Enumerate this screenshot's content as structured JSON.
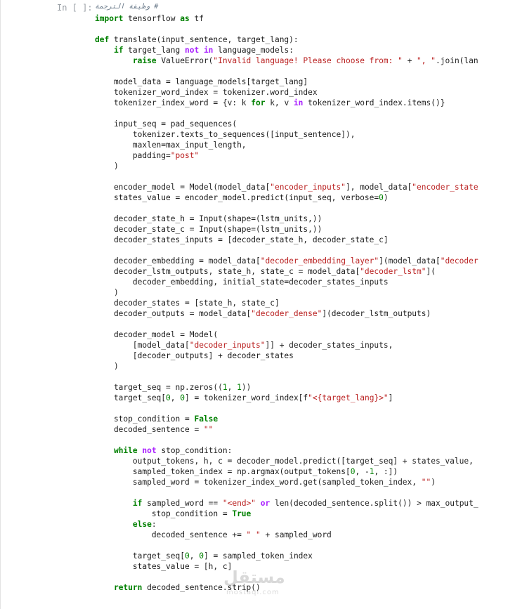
{
  "cell": {
    "prompt": "In [ ]:",
    "lines": [
      [
        [
          "cm",
          "# وظيفة الترجمة"
        ]
      ],
      [
        [
          "kw",
          "import"
        ],
        [
          "p",
          " tensorflow "
        ],
        [
          "kw",
          "as"
        ],
        [
          "p",
          " tf"
        ]
      ],
      [],
      [
        [
          "kw",
          "def"
        ],
        [
          "p",
          " translate(input_sentence, target_lang):"
        ]
      ],
      [
        [
          "p",
          "    "
        ],
        [
          "kw",
          "if"
        ],
        [
          "p",
          " target_lang "
        ],
        [
          "op",
          "not in"
        ],
        [
          "p",
          " language_models:"
        ]
      ],
      [
        [
          "p",
          "        "
        ],
        [
          "kw",
          "raise"
        ],
        [
          "p",
          " ValueError("
        ],
        [
          "str",
          "\"Invalid language! Please choose from: \""
        ],
        [
          "p",
          " + "
        ],
        [
          "str",
          "\", \""
        ],
        [
          "p",
          ".join(lan"
        ]
      ],
      [],
      [
        [
          "p",
          "    model_data = language_models[target_lang]"
        ]
      ],
      [
        [
          "p",
          "    tokenizer_word_index = tokenizer.word_index"
        ]
      ],
      [
        [
          "p",
          "    tokenizer_index_word = {v: k "
        ],
        [
          "kw",
          "for"
        ],
        [
          "p",
          " k, v "
        ],
        [
          "op",
          "in"
        ],
        [
          "p",
          " tokenizer_word_index.items()}"
        ]
      ],
      [],
      [
        [
          "p",
          "    input_seq = pad_sequences("
        ]
      ],
      [
        [
          "p",
          "        tokenizer.texts_to_sequences([input_sentence]),"
        ]
      ],
      [
        [
          "p",
          "        maxlen=max_input_length,"
        ]
      ],
      [
        [
          "p",
          "        padding="
        ],
        [
          "str",
          "\"post\""
        ]
      ],
      [
        [
          "p",
          "    )"
        ]
      ],
      [],
      [
        [
          "p",
          "    encoder_model = Model(model_data["
        ],
        [
          "str",
          "\"encoder_inputs\""
        ],
        [
          "p",
          "], model_data["
        ],
        [
          "str",
          "\"encoder_state"
        ]
      ],
      [
        [
          "p",
          "    states_value = encoder_model.predict(input_seq, verbose="
        ],
        [
          "num",
          "0"
        ],
        [
          "p",
          ")"
        ]
      ],
      [],
      [
        [
          "p",
          "    decoder_state_h = Input(shape=(lstm_units,))"
        ]
      ],
      [
        [
          "p",
          "    decoder_state_c = Input(shape=(lstm_units,))"
        ]
      ],
      [
        [
          "p",
          "    decoder_states_inputs = [decoder_state_h, decoder_state_c]"
        ]
      ],
      [],
      [
        [
          "p",
          "    decoder_embedding = model_data["
        ],
        [
          "str",
          "\"decoder_embedding_layer\""
        ],
        [
          "p",
          "](model_data["
        ],
        [
          "str",
          "\"decoder"
        ]
      ],
      [
        [
          "p",
          "    decoder_lstm_outputs, state_h, state_c = model_data["
        ],
        [
          "str",
          "\"decoder_lstm\""
        ],
        [
          "p",
          "]("
        ]
      ],
      [
        [
          "p",
          "        decoder_embedding, initial_state=decoder_states_inputs"
        ]
      ],
      [
        [
          "p",
          "    )"
        ]
      ],
      [
        [
          "p",
          "    decoder_states = [state_h, state_c]"
        ]
      ],
      [
        [
          "p",
          "    decoder_outputs = model_data["
        ],
        [
          "str",
          "\"decoder_dense\""
        ],
        [
          "p",
          "](decoder_lstm_outputs)"
        ]
      ],
      [],
      [
        [
          "p",
          "    decoder_model = Model("
        ]
      ],
      [
        [
          "p",
          "        [model_data["
        ],
        [
          "str",
          "\"decoder_inputs\""
        ],
        [
          "p",
          "]] + decoder_states_inputs,"
        ]
      ],
      [
        [
          "p",
          "        [decoder_outputs] + decoder_states"
        ]
      ],
      [
        [
          "p",
          "    )"
        ]
      ],
      [],
      [
        [
          "p",
          "    target_seq = np.zeros(("
        ],
        [
          "num",
          "1"
        ],
        [
          "p",
          ", "
        ],
        [
          "num",
          "1"
        ],
        [
          "p",
          "))"
        ]
      ],
      [
        [
          "p",
          "    target_seq["
        ],
        [
          "num",
          "0"
        ],
        [
          "p",
          ", "
        ],
        [
          "num",
          "0"
        ],
        [
          "p",
          "] = tokenizer_word_index[f"
        ],
        [
          "str",
          "\"<{target_lang}>\""
        ],
        [
          "p",
          "]"
        ]
      ],
      [],
      [
        [
          "p",
          "    stop_condition = "
        ],
        [
          "kw",
          "False"
        ]
      ],
      [
        [
          "p",
          "    decoded_sentence = "
        ],
        [
          "str",
          "\"\""
        ]
      ],
      [],
      [
        [
          "p",
          "    "
        ],
        [
          "kw",
          "while"
        ],
        [
          "p",
          " "
        ],
        [
          "op",
          "not"
        ],
        [
          "p",
          " stop_condition:"
        ]
      ],
      [
        [
          "p",
          "        output_tokens, h, c = decoder_model.predict([target_seq] + states_value,"
        ]
      ],
      [
        [
          "p",
          "        sampled_token_index = np.argmax(output_tokens["
        ],
        [
          "num",
          "0"
        ],
        [
          "p",
          ", -"
        ],
        [
          "num",
          "1"
        ],
        [
          "p",
          ", :])"
        ]
      ],
      [
        [
          "p",
          "        sampled_word = tokenizer_index_word.get(sampled_token_index, "
        ],
        [
          "str",
          "\"\""
        ],
        [
          "p",
          ")"
        ]
      ],
      [],
      [
        [
          "p",
          "        "
        ],
        [
          "kw",
          "if"
        ],
        [
          "p",
          " sampled_word == "
        ],
        [
          "str",
          "\"<end>\""
        ],
        [
          "p",
          " "
        ],
        [
          "op",
          "or"
        ],
        [
          "p",
          " len(decoded_sentence.split()) > max_output_"
        ]
      ],
      [
        [
          "p",
          "            stop_condition = "
        ],
        [
          "kw",
          "True"
        ]
      ],
      [
        [
          "p",
          "        "
        ],
        [
          "kw",
          "else"
        ],
        [
          "p",
          ":"
        ]
      ],
      [
        [
          "p",
          "            decoded_sentence += "
        ],
        [
          "str",
          "\" \""
        ],
        [
          "p",
          " + sampled_word"
        ]
      ],
      [],
      [
        [
          "p",
          "        target_seq["
        ],
        [
          "num",
          "0"
        ],
        [
          "p",
          ", "
        ],
        [
          "num",
          "0"
        ],
        [
          "p",
          "] = sampled_token_index"
        ]
      ],
      [
        [
          "p",
          "        states_value = [h, c]"
        ]
      ],
      [],
      [
        [
          "p",
          "    "
        ],
        [
          "kw",
          "return"
        ],
        [
          "p",
          " decoded_sentence.strip()"
        ]
      ]
    ]
  },
  "watermark": {
    "arabic": "مستقل",
    "latin": "mostaql.com"
  }
}
